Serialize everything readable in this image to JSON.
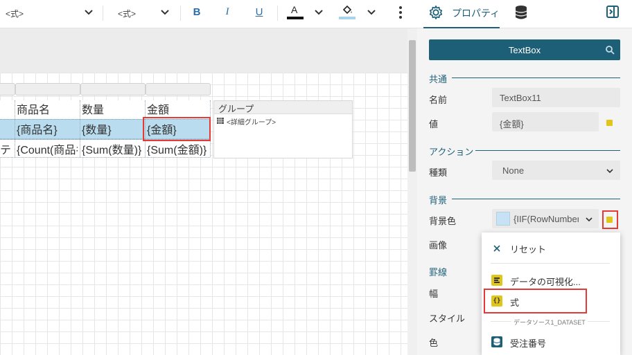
{
  "toolbar": {
    "expr1": "<式>",
    "expr2": "<式>",
    "bold": "B",
    "italic": "I",
    "underline": "U",
    "font_color_letter": "A",
    "font_color": "#111111",
    "fill_color": "#a8d3ee"
  },
  "panel_tabs": {
    "properties_label": "プロパティ"
  },
  "report": {
    "headers": [
      "商品名",
      "数量",
      "金額"
    ],
    "detail": [
      "{商品名}",
      "{数量}",
      "{金額}"
    ],
    "totals": [
      "テ",
      "{Count(商品名)}",
      "{Sum(数量)}",
      "{Sum(金額)}"
    ],
    "group_title": "グループ",
    "group_item": "<詳細グループ>"
  },
  "properties": {
    "header": "TextBox",
    "common_section": "共通",
    "name_label": "名前",
    "name_value": "TextBox11",
    "value_label": "値",
    "value_value": "{金額}",
    "action_section": "アクション",
    "kind_label": "種類",
    "kind_value": "None",
    "background_section": "背景",
    "bgcolor_label": "背景色",
    "bgcolor_value": "{IIF(RowNumber(",
    "bgcolor_swatch": "#c6e2f4",
    "image_label": "画像",
    "border_section": "罫線",
    "width_label": "幅",
    "style_label": "スタイル",
    "color_label": "色",
    "accent": "#1e5f78"
  },
  "menu": {
    "reset": "リセット",
    "visualize": "データの可視化...",
    "expression": "式",
    "dataset": "データソース1_DATASET",
    "field": "受注番号"
  }
}
